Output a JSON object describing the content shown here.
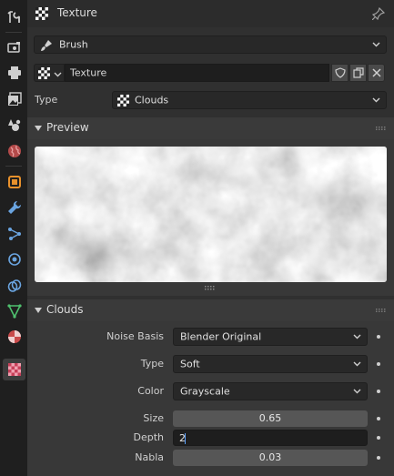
{
  "header": {
    "title": "Texture",
    "icon": "checker-texture-icon",
    "pin_icon": "pin-icon"
  },
  "tabs": [
    {
      "name": "tool-tab",
      "icon": "wrench-screwdriver-icon"
    },
    {
      "name": "render-tab",
      "icon": "camera-back-icon"
    },
    {
      "name": "output-tab",
      "icon": "printer-icon"
    },
    {
      "name": "view-layer-tab",
      "icon": "image-stack-icon"
    },
    {
      "name": "scene-tab",
      "icon": "cone-sphere-icon"
    },
    {
      "name": "world-tab",
      "icon": "globe-icon"
    },
    {
      "name": "object-tab",
      "icon": "orange-square-icon"
    },
    {
      "name": "modifier-tab",
      "icon": "wrench-icon"
    },
    {
      "name": "particles-tab",
      "icon": "nodes-icon"
    },
    {
      "name": "physics-tab",
      "icon": "orbit-icon"
    },
    {
      "name": "constraints-tab",
      "icon": "link-icon"
    },
    {
      "name": "data-tab",
      "icon": "triangle-mesh-icon"
    },
    {
      "name": "material-tab",
      "icon": "material-sphere-icon"
    },
    {
      "name": "texture-tab",
      "icon": "checker-texture-icon",
      "active": true
    }
  ],
  "context": {
    "value": "Brush",
    "icon": "brush-icon"
  },
  "texture_name": "Texture",
  "texture_buttons": [
    "fake-user-icon",
    "duplicate-icon",
    "close-icon"
  ],
  "type_row": {
    "label": "Type",
    "value": "Clouds"
  },
  "preview_panel": {
    "title": "Preview"
  },
  "clouds_panel": {
    "title": "Clouds",
    "noise_basis": {
      "label": "Noise Basis",
      "value": "Blender Original"
    },
    "type": {
      "label": "Type",
      "value": "Soft"
    },
    "color": {
      "label": "Color",
      "value": "Grayscale"
    },
    "size": {
      "label": "Size",
      "value": "0.65"
    },
    "depth": {
      "label": "Depth",
      "value": "2"
    },
    "nabla": {
      "label": "Nabla",
      "value": "0.03"
    }
  },
  "colors": {
    "editor_bg": "#303030",
    "panel_bg": "#383838",
    "field": "#565656",
    "accent": "#5aa0ff"
  }
}
